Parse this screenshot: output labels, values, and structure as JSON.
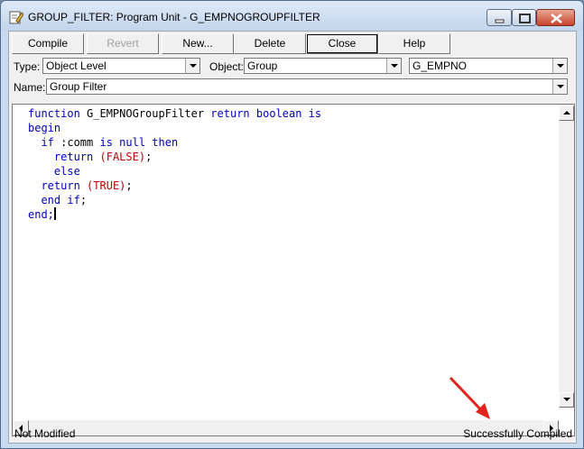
{
  "window": {
    "title": "GROUP_FILTER: Program Unit - G_EMPNOGROUPFILTER"
  },
  "toolbar": {
    "compile": "Compile",
    "revert": "Revert",
    "new": "New...",
    "delete": "Delete",
    "close": "Close",
    "help": "Help"
  },
  "selectors": {
    "type_label": "Type:",
    "type_value": "Object Level",
    "object_label": "Object:",
    "object_value": "Group",
    "object_name_value": "G_EMPNO",
    "name_label": "Name:",
    "name_value": "Group Filter"
  },
  "code": {
    "l1_kw1": "function",
    "l1_name": " G_EMPNOGroupFilter ",
    "l1_kw2": "return boolean is",
    "l2": "begin",
    "l3_kw1": "if",
    "l3_mid": " :comm ",
    "l3_kw2": "is null then",
    "l4_kw": "return",
    "l4_lit": "(FALSE)",
    "l4_end": ";",
    "l5": "else",
    "l6_kw": "return",
    "l6_lit": "(TRUE)",
    "l6_end": ";",
    "l7_kw": "end if",
    "l7_end": ";",
    "l8": "end;"
  },
  "status": {
    "left": "Not Modified",
    "right": "Successfully Compiled"
  },
  "colors": {
    "keyword": "#0000c0",
    "literal": "#c00000",
    "annotation_arrow": "#e3231c"
  }
}
